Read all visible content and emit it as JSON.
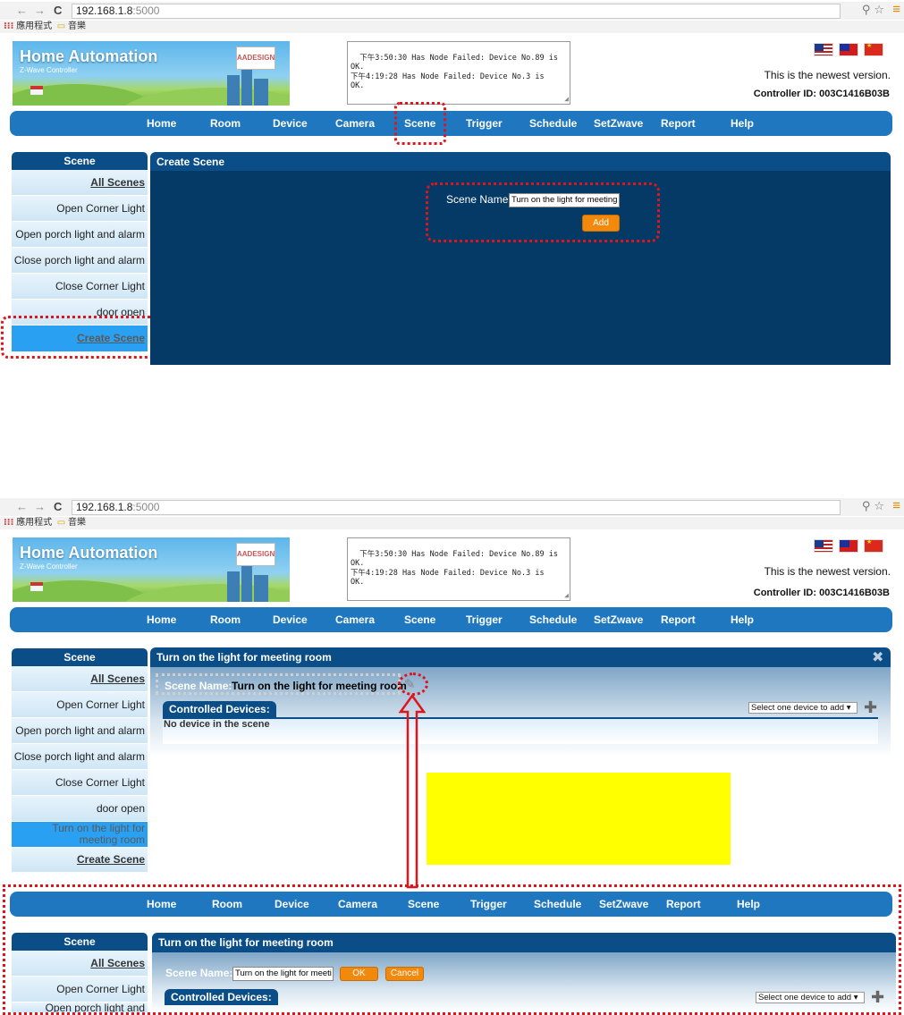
{
  "browser": {
    "url_host": "192.168.1.8",
    "url_port": ":5000",
    "bookmarks": [
      "應用程式",
      "音樂"
    ]
  },
  "header": {
    "title": "Home Automation",
    "subtitle": "Z-Wave Controller",
    "logo_text": "AADESIGN",
    "log_text": "下午3:50:30 Has Node Failed: Device No.89 is\nOK.\n下午4:19:28 Has Node Failed: Device No.3 is\nOK.",
    "version_text": "This is the newest version.",
    "controller_id": "Controller ID: 003C1416B03B"
  },
  "nav": [
    "Home",
    "Room",
    "Device",
    "Camera",
    "Scene",
    "Trigger",
    "Schedule",
    "SetZwave",
    "Report",
    "Help"
  ],
  "sidebar": {
    "heading": "Scene",
    "items_top": [
      "All Scenes",
      "Open Corner Light",
      "Open porch light and alarm",
      "Close porch light and alarm",
      "Close Corner Light",
      "door open",
      "Create Scene"
    ],
    "items_mid": [
      "All Scenes",
      "Open Corner Light",
      "Open porch light and alarm",
      "Close porch light and alarm",
      "Close Corner Light",
      "door open",
      "Turn on the light for meeting room",
      "Create Scene"
    ],
    "items_bottom": [
      "All Scenes",
      "Open Corner Light",
      "Open porch light and"
    ]
  },
  "create_panel": {
    "heading": "Create Scene",
    "scene_name_label": "Scene Name:",
    "scene_name_value": "Turn on the light for meeting r",
    "add_label": "Add"
  },
  "scene_panel": {
    "heading": "Turn on the light for meeting room",
    "scene_name_label": "Scene Name:",
    "scene_name_value": "Turn on the light for meeting room",
    "controlled_devices": "Controlled Devices:",
    "no_device": "No device in the scene",
    "select_device": "Select one device to add"
  },
  "edit_panel": {
    "heading": "Turn on the light for meeting room",
    "scene_name_label": "Scene Name:",
    "scene_name_value": "Turn on the light for meeti",
    "ok_label": "OK",
    "cancel_label": "Cancel",
    "controlled_devices": "Controlled Devices:",
    "select_device": "Select one device to add"
  },
  "colors": {
    "nav_blue": "#1f78bf",
    "panel_dark": "#053a66",
    "header_dark": "#0b4e87",
    "accent_orange": "#f2890c",
    "annotation_red": "#e0141b",
    "highlight_yellow": "#ffff00"
  }
}
